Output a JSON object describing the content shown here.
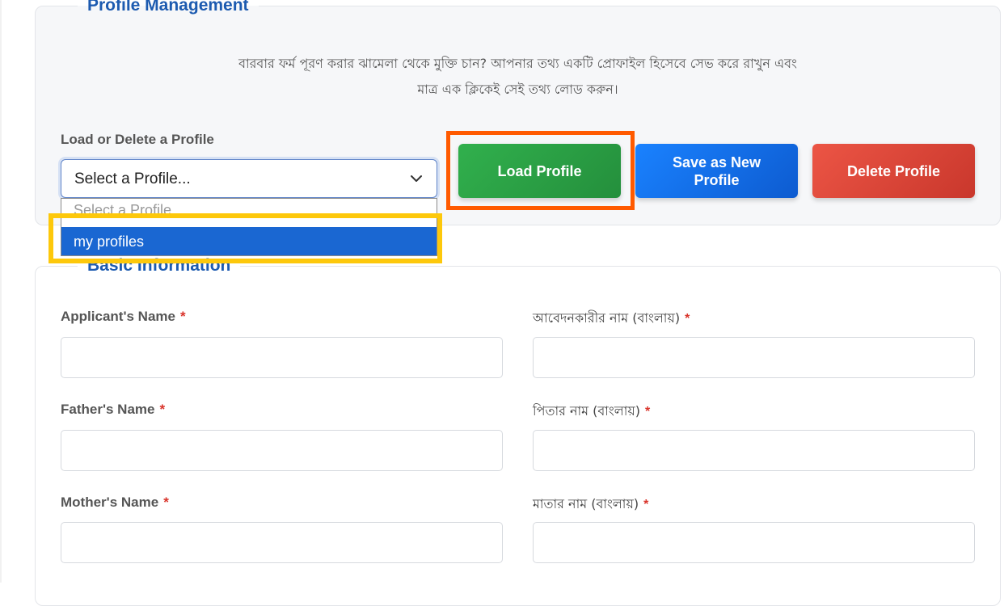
{
  "profile_management": {
    "title": "Profile Management",
    "intro_line1": "বারবার ফর্ম পূরণ করার ঝামেলা থেকে মুক্তি চান? আপনার তথ্য একটি প্রোফাইল হিসেবে সেভ করে রাখুন এবং",
    "intro_line2": "মাত্র এক ক্লিকেই সেই তথ্য লোড করুন।",
    "select_label": "Load or Delete a Profile",
    "select_value": "Select a Profile...",
    "options": [
      "Select a Profile...",
      "my profiles"
    ],
    "buttons": {
      "load": "Load Profile",
      "save": "Save as New Profile",
      "delete": "Delete Profile"
    }
  },
  "basic_information": {
    "title": "Basic Information",
    "required_marker": "*",
    "fields": [
      {
        "label": "Applicant's Name",
        "value": ""
      },
      {
        "label": "আবেদনকারীর নাম (বাংলায়)",
        "value": ""
      },
      {
        "label": "Father's Name",
        "value": ""
      },
      {
        "label": "পিতার নাম (বাংলায়)",
        "value": ""
      },
      {
        "label": "Mother's Name",
        "value": ""
      },
      {
        "label": "মাতার নাম (বাংলায়)",
        "value": ""
      }
    ]
  },
  "colors": {
    "heading": "#1d5bb0",
    "load_button": "#2a9e44",
    "save_button": "#1470ea",
    "delete_button": "#dc4538",
    "selected_option": "#1a67d2",
    "highlight_orange": "#ff5a00",
    "highlight_yellow": "#fdc80b",
    "required": "#d9342b"
  },
  "icons": {
    "select_arrow": "chevron-down-icon"
  }
}
